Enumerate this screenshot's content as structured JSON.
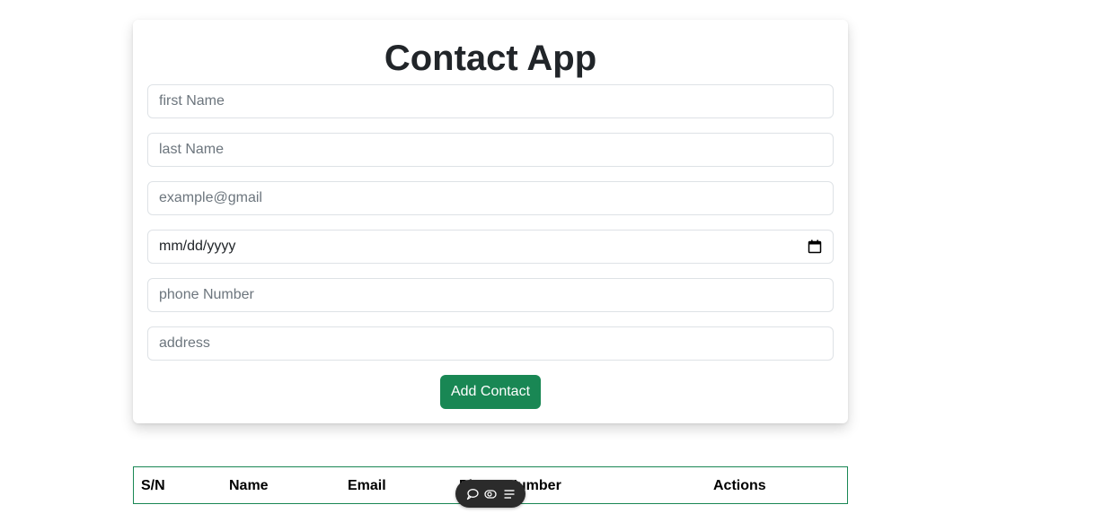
{
  "app": {
    "title": "Contact App"
  },
  "form": {
    "first_name": {
      "placeholder": "first Name",
      "value": ""
    },
    "last_name": {
      "placeholder": "last Name",
      "value": ""
    },
    "email": {
      "placeholder": "example@gmail",
      "value": ""
    },
    "dob": {
      "display": "mm/dd/yyyy"
    },
    "phone": {
      "placeholder": "phone Number",
      "value": ""
    },
    "address": {
      "placeholder": "address",
      "value": ""
    },
    "submit_label": "Add Contact"
  },
  "table": {
    "headers": [
      "S/N",
      "Name",
      "Email",
      "Phone Number",
      "Actions"
    ],
    "rows": []
  },
  "floating_toolbar": {
    "icons": [
      "comment-icon",
      "eye-icon",
      "menu-icon"
    ]
  },
  "colors": {
    "accent": "#198754",
    "border": "#dee2e6",
    "placeholder": "#6c757d"
  }
}
